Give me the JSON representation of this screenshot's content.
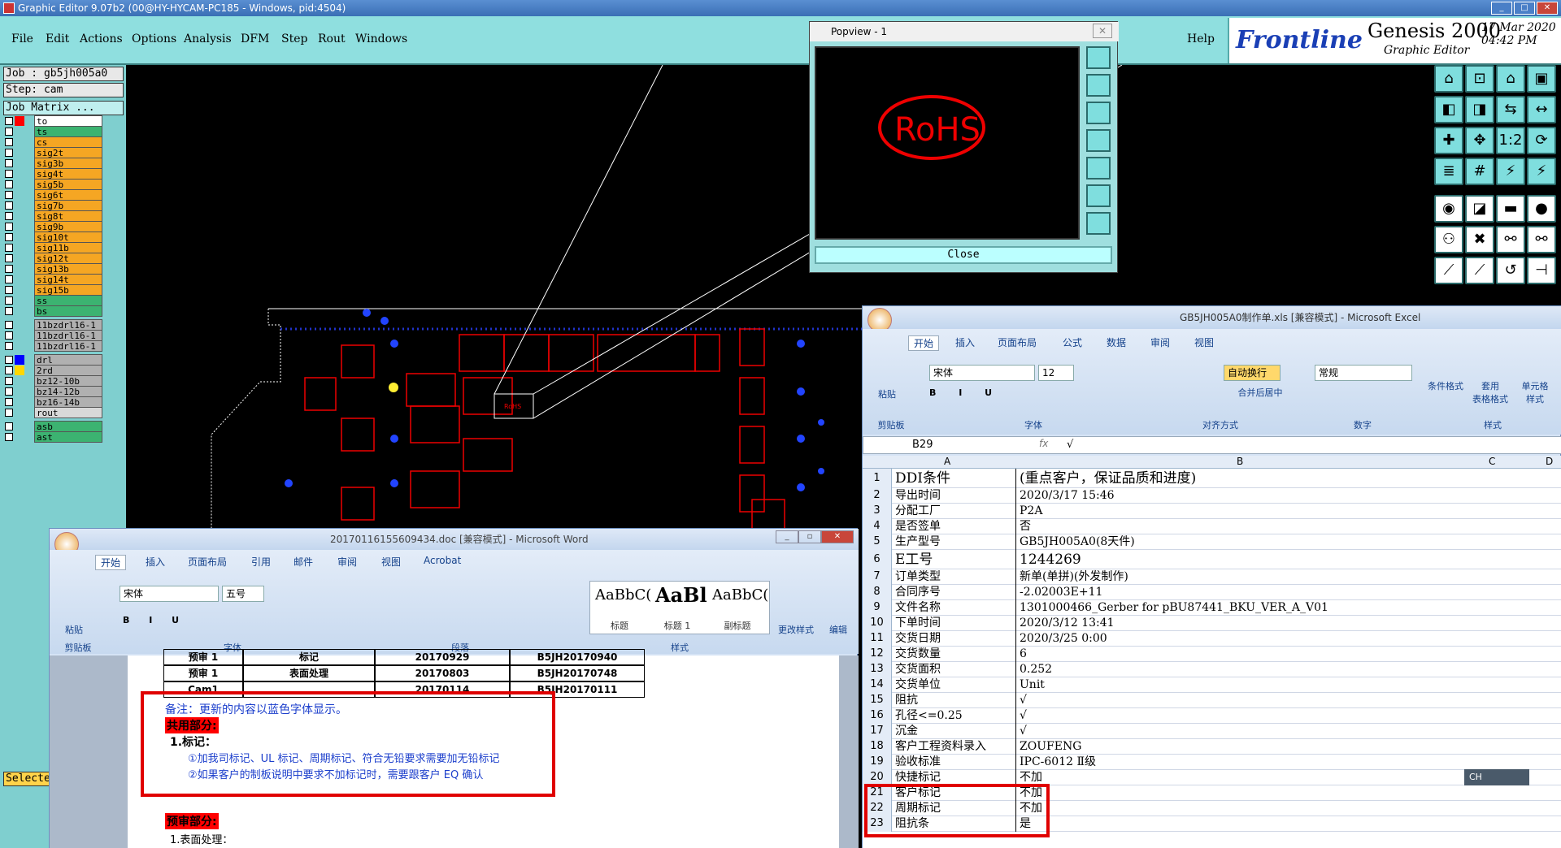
{
  "genesis": {
    "title": "Graphic Editor 9.07b2 (00@HY-HYCAM-PC185 - Windows, pid:4504)",
    "menu": [
      "File",
      "Edit",
      "Actions",
      "Options",
      "Analysis",
      "DFM",
      "Step",
      "Rout",
      "Windows"
    ],
    "help": "Help",
    "brand": "Frontline",
    "product": "Genesis 2000",
    "product_sub": "Graphic Editor",
    "date": "17 Mar 2020",
    "time": "04:42 PM",
    "job": "Job : gb5jh005a0",
    "step": "Step: cam",
    "job_matrix": "Job Matrix ...",
    "layers": [
      {
        "name": "to",
        "color": "#ff0000",
        "bg": "#ffffff"
      },
      {
        "name": "ts",
        "color": "",
        "bg": "#3cb371"
      },
      {
        "name": "cs",
        "color": "",
        "bg": "#f5a623"
      },
      {
        "name": "sig2t",
        "color": "",
        "bg": "#f5a623"
      },
      {
        "name": "sig3b",
        "color": "",
        "bg": "#f5a623"
      },
      {
        "name": "sig4t",
        "color": "",
        "bg": "#f5a623"
      },
      {
        "name": "sig5b",
        "color": "",
        "bg": "#f5a623"
      },
      {
        "name": "sig6t",
        "color": "",
        "bg": "#f5a623"
      },
      {
        "name": "sig7b",
        "color": "",
        "bg": "#f5a623"
      },
      {
        "name": "sig8t",
        "color": "",
        "bg": "#f5a623"
      },
      {
        "name": "sig9b",
        "color": "",
        "bg": "#f5a623"
      },
      {
        "name": "sig10t",
        "color": "",
        "bg": "#f5a623"
      },
      {
        "name": "sig11b",
        "color": "",
        "bg": "#f5a623"
      },
      {
        "name": "sig12t",
        "color": "",
        "bg": "#f5a623"
      },
      {
        "name": "sig13b",
        "color": "",
        "bg": "#f5a623"
      },
      {
        "name": "sig14t",
        "color": "",
        "bg": "#f5a623"
      },
      {
        "name": "sig15b",
        "color": "",
        "bg": "#f5a623"
      },
      {
        "name": "ss",
        "color": "",
        "bg": "#3cb371"
      },
      {
        "name": "bs",
        "color": "",
        "bg": "#3cb371"
      },
      {
        "name": "11bzdrl16-1",
        "color": "",
        "bg": "#b0b0b0"
      },
      {
        "name": "11bzdrl16-1",
        "color": "",
        "bg": "#b0b0b0"
      },
      {
        "name": "11bzdrl16-1",
        "color": "",
        "bg": "#b0b0b0"
      },
      {
        "name": "drl",
        "color": "#0000ff",
        "bg": "#b0b0b0"
      },
      {
        "name": "2rd",
        "color": "#ffd700",
        "bg": "#b0b0b0"
      },
      {
        "name": "bz12-10b",
        "color": "",
        "bg": "#b0b0b0"
      },
      {
        "name": "bz14-12b",
        "color": "",
        "bg": "#b0b0b0"
      },
      {
        "name": "bz16-14b",
        "color": "",
        "bg": "#b0b0b0"
      },
      {
        "name": "rout",
        "color": "",
        "bg": "#d8d8d8"
      },
      {
        "name": "asb",
        "color": "",
        "bg": "#3cb371"
      },
      {
        "name": "ast",
        "color": "",
        "bg": "#3cb371"
      }
    ],
    "selected": "Selecte",
    "canvas_mark": "RoHS",
    "popview": {
      "title": "Popview - 1",
      "close": "Close",
      "mark": "RoHS"
    }
  },
  "excel": {
    "title": "GB5JH005A0制作单.xls [兼容模式] - Microsoft Excel",
    "tabs": [
      "开始",
      "插入",
      "页面布局",
      "公式",
      "数据",
      "审阅",
      "视图"
    ],
    "font_name": "宋体",
    "font_size": "12",
    "number_format": "常规",
    "wrap_text": "自动换行",
    "merge_center": "合并后居中",
    "paste": "粘贴",
    "cond_format": "条件格式",
    "table_format": "套用\n表格格式",
    "cell_style": "单元格\n样式",
    "groups": [
      "剪贴板",
      "字体",
      "对齐方式",
      "数字",
      "样式"
    ],
    "name_box": "B29",
    "formula": "√",
    "columns": [
      "A",
      "B",
      "C",
      "D"
    ],
    "rows": [
      {
        "n": "1",
        "a": "DDI条件",
        "b": "(重点客户，保证品质和进度)",
        "big": true
      },
      {
        "n": "2",
        "a": "导出时间",
        "b": "2020/3/17 15:46"
      },
      {
        "n": "3",
        "a": "分配工厂",
        "b": "P2A"
      },
      {
        "n": "4",
        "a": "是否签单",
        "b": "否"
      },
      {
        "n": "5",
        "a": "生产型号",
        "b": "GB5JH005A0(8天件)"
      },
      {
        "n": "6",
        "a": "E工号",
        "b": "1244269",
        "big": true
      },
      {
        "n": "7",
        "a": "订单类型",
        "b": "新单(单拼)(外发制作)"
      },
      {
        "n": "8",
        "a": "合同序号",
        "b": "-2.02003E+11"
      },
      {
        "n": "9",
        "a": "文件名称",
        "b": "1301000466_Gerber for pBU87441_BKU_VER_A_V01"
      },
      {
        "n": "10",
        "a": "下单时间",
        "b": "2020/3/12 13:41"
      },
      {
        "n": "11",
        "a": "交货日期",
        "b": "2020/3/25 0:00"
      },
      {
        "n": "12",
        "a": "交货数量",
        "b": "6"
      },
      {
        "n": "13",
        "a": "交货面积",
        "b": "0.252"
      },
      {
        "n": "14",
        "a": "交货单位",
        "b": "Unit"
      },
      {
        "n": "15",
        "a": "阻抗",
        "b": "√"
      },
      {
        "n": "16",
        "a": "孔径<=0.25",
        "b": "√"
      },
      {
        "n": "17",
        "a": "沉金",
        "b": "√"
      },
      {
        "n": "18",
        "a": "客户工程资料录入",
        "b": "ZOUFENG"
      },
      {
        "n": "19",
        "a": "验收标准",
        "b": "IPC-6012 Ⅱ级"
      },
      {
        "n": "20",
        "a": "快捷标记",
        "b": "不加"
      },
      {
        "n": "21",
        "a": "客户标记",
        "b": "不加"
      },
      {
        "n": "22",
        "a": "周期标记",
        "b": "不加"
      },
      {
        "n": "23",
        "a": "阻抗条",
        "b": "是"
      }
    ],
    "ime": "CH"
  },
  "word": {
    "title": "20170116155609434.doc [兼容模式] - Microsoft Word",
    "tabs": [
      "开始",
      "插入",
      "页面布局",
      "引用",
      "邮件",
      "审阅",
      "视图",
      "Acrobat"
    ],
    "font_name": "宋体",
    "font_size": "五号",
    "styles": [
      {
        "sample": "AaBbC(",
        "name": "标题"
      },
      {
        "sample": "AaBl",
        "name": "标题 1"
      },
      {
        "sample": "AaBbC(",
        "name": "副标题"
      }
    ],
    "change_style": "更改样式",
    "edit": "编辑",
    "paste": "粘贴",
    "groups": [
      "剪贴板",
      "字体",
      "段落",
      "样式"
    ],
    "table_rows": [
      [
        "预审 1",
        "标记",
        "20170929",
        "B5JH20170940"
      ],
      [
        "预审 1",
        "表面处理",
        "20170803",
        "B5JH20170748"
      ],
      [
        "Cam1",
        "",
        "20170114",
        "B5JH20170111"
      ]
    ],
    "note": "备注：更新的内容以蓝色字体显示。",
    "shared": "共用部分:",
    "item1": "1.标记：",
    "line1": "①加我司标记、UL 标记、周期标记、符合无铅要求需要加无铅标记",
    "line2": "②如果客户的制板说明中要求不加标记时，需要跟客户 EQ 确认",
    "presale": "预审部分:",
    "item2": "1.表面处理："
  }
}
